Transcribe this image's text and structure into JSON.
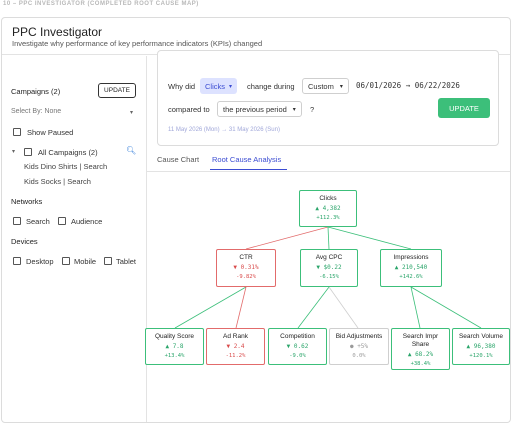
{
  "caption": "10 – PPC INVESTIGATOR (COMPLETED ROOT CAUSE MAP)",
  "header": {
    "title": "PPC Investigator",
    "subtitle": "Investigate why performance of key performance indicators (KPIs) changed"
  },
  "sidebar": {
    "campaigns_heading": "Campaigns (2)",
    "update_label": "UPDATE",
    "select_by": "Select By: None",
    "show_paused": "Show Paused",
    "all_campaigns": "All Campaigns (2)",
    "campaigns": [
      "Kids Dino Shirts | Search",
      "Kids Socks | Search"
    ],
    "networks_heading": "Networks",
    "networks": [
      "Search",
      "Audience"
    ],
    "devices_heading": "Devices",
    "devices": [
      "Desktop",
      "Mobile",
      "Tablet"
    ]
  },
  "query": {
    "why_did": "Why did",
    "metric": "Clicks",
    "change_during": "change during",
    "period": "Custom",
    "date_range": "06/01/2026 → 06/22/2026",
    "compared_to": "compared to",
    "comparison": "the previous period",
    "question_mark": "?",
    "comparison_range": "11 May 2026 (Mon) → 31 May 2026 (Sun)",
    "update_label": "UPDATE"
  },
  "tabs": [
    "Cause Chart",
    "Root Cause Analysis"
  ],
  "tree": {
    "root": {
      "label": "Clicks",
      "value": "▲ 4,382",
      "change": "+112.3%"
    },
    "ctr": {
      "label": "CTR",
      "value": "▼ 0.31%",
      "change": "-9.82%"
    },
    "avg_cpc": {
      "label": "Avg CPC",
      "value": "▼ $0.22",
      "change": "-6.15%"
    },
    "impressions": {
      "label": "Impressions",
      "value": "▲ 210,540",
      "change": "+142.6%"
    },
    "quality_score": {
      "label": "Quality Score",
      "value": "▲ 7.8",
      "change": "+13.4%"
    },
    "ad_rank": {
      "label": "Ad Rank",
      "value": "▼ 2.4",
      "change": "-11.2%"
    },
    "competition": {
      "label": "Competition",
      "value": "▼ 0.62",
      "change": "-9.0%"
    },
    "bid_adjustments": {
      "label": "Bid Adjustments",
      "value": "● +5%",
      "change": "0.0%"
    },
    "search_impr_share": {
      "label": "Search Impr Share",
      "value": "▲ 68.2%",
      "change": "+38.4%"
    },
    "search_volume": {
      "label": "Search Volume",
      "value": "▲ 96,380",
      "change": "+120.1%"
    }
  },
  "colors": {
    "positive": "#3cbf7a",
    "negative": "#e26b6b",
    "neutral": "#cfcfcf",
    "accent": "#3b4cd2"
  }
}
